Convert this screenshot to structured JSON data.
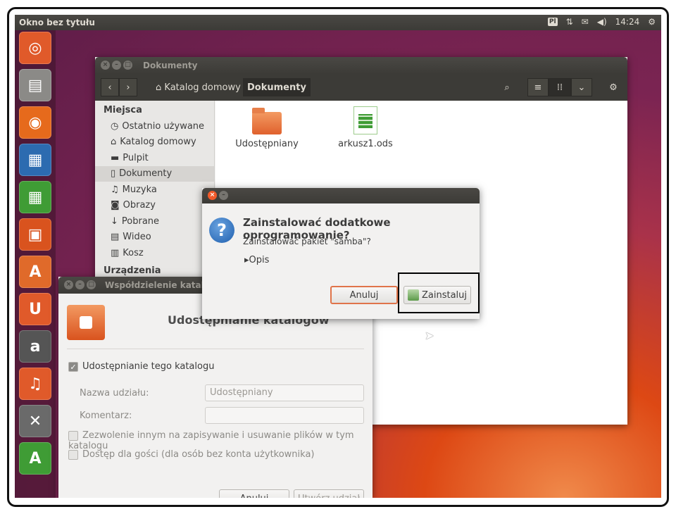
{
  "top_panel": {
    "title": "Okno bez tytułu",
    "keyboard": "Pl",
    "time": "14:24"
  },
  "launcher": [
    {
      "name": "ubuntu-dash-icon",
      "glyph": "◎",
      "bg": "#e05a2a"
    },
    {
      "name": "files-icon",
      "glyph": "▤",
      "bg": "#8b8a87"
    },
    {
      "name": "firefox-icon",
      "glyph": "◉",
      "bg": "#e66a1c"
    },
    {
      "name": "writer-icon",
      "glyph": "▦",
      "bg": "#2c6bb0"
    },
    {
      "name": "calc-icon",
      "glyph": "▦",
      "bg": "#3f9c35"
    },
    {
      "name": "impress-icon",
      "glyph": "▣",
      "bg": "#d9531e"
    },
    {
      "name": "software-center-icon",
      "glyph": "A",
      "bg": "#e06a2a"
    },
    {
      "name": "ubuntu-one-icon",
      "glyph": "U",
      "bg": "#e05a2a"
    },
    {
      "name": "amazon-icon",
      "glyph": "a",
      "bg": "#555"
    },
    {
      "name": "ubuntu-one-music-icon",
      "glyph": "♫",
      "bg": "#e05a2a"
    },
    {
      "name": "system-settings-icon",
      "glyph": "✕",
      "bg": "#6a6a6a"
    },
    {
      "name": "software-updater-icon",
      "glyph": "A",
      "bg": "#3f9c35"
    }
  ],
  "nautilus": {
    "title": "Dokumenty",
    "breadcrumb": [
      "Katalog domowy",
      "Dokumenty"
    ],
    "sidebar_header_places": "Miejsca",
    "sidebar_items": [
      {
        "label": "Ostatnio używane",
        "icon": "◷"
      },
      {
        "label": "Katalog domowy",
        "icon": "⌂"
      },
      {
        "label": "Pulpit",
        "icon": "▬"
      },
      {
        "label": "Dokumenty",
        "icon": "▯"
      },
      {
        "label": "Muzyka",
        "icon": "♫"
      },
      {
        "label": "Obrazy",
        "icon": "◙"
      },
      {
        "label": "Pobrane",
        "icon": "↓"
      },
      {
        "label": "Wideo",
        "icon": "▤"
      },
      {
        "label": "Kosz",
        "icon": "▥"
      }
    ],
    "sidebar_header_devices": "Urządzenia",
    "files": [
      {
        "name": "Udostępniany",
        "type": "folder"
      },
      {
        "name": "arkusz1.ods",
        "type": "spreadsheet"
      }
    ]
  },
  "sharing": {
    "title": "Współdzielenie katalogu",
    "heading": "Udostępnianie katalogów",
    "share_checkbox": "Udostępnianie tego katalogu",
    "share_name_label": "Nazwa udziału:",
    "share_name_value": "Udostępniany",
    "comment_label": "Komentarz:",
    "comment_value": "",
    "allow_write": "Zezwolenie innym na zapisywanie i usuwanie plików w tym katalogu",
    "guest_access": "Dostęp dla gości (dla osób bez konta użytkownika)",
    "cancel": "Anuluj",
    "create": "Utwórz udział"
  },
  "dialog": {
    "heading": "Zainstalować dodatkowe oprogramowanie?",
    "message": "Zainstalować pakiet \"samba\"?",
    "details": "Opis",
    "cancel": "Anuluj",
    "install": "Zainstaluj"
  }
}
